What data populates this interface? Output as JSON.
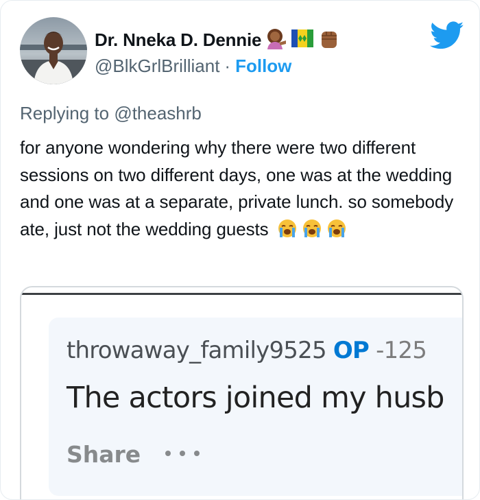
{
  "author": {
    "name": "Dr. Nneka D. Dennie",
    "handle": "@BlkGrlBrilliant",
    "separator": "·",
    "follow_label": "Follow",
    "emojis": [
      "woman-tipping-hand-emoji",
      "saint-vincent-flag-emoji",
      "raised-fist-emoji"
    ]
  },
  "reply": {
    "prefix": "Replying to",
    "mention": "@theashrb"
  },
  "tweet": {
    "text": "for anyone wondering why there were two different sessions on two different days, one was at the wedding and one was at a separate, private lunch. so somebody ate, just not the wedding guests",
    "trailing_emojis": [
      "loudly-crying-face-emoji",
      "loudly-crying-face-emoji",
      "loudly-crying-face-emoji"
    ]
  },
  "embedded_comment": {
    "username": "throwaway_family9525",
    "op_badge": "OP",
    "score": "-125",
    "body": "The actors joined my husb",
    "share_label": "Share",
    "more_label": "•••"
  },
  "colors": {
    "twitter_blue": "#1d9bf0",
    "reddit_op_blue": "#0079d3",
    "secondary_text": "#536471"
  }
}
